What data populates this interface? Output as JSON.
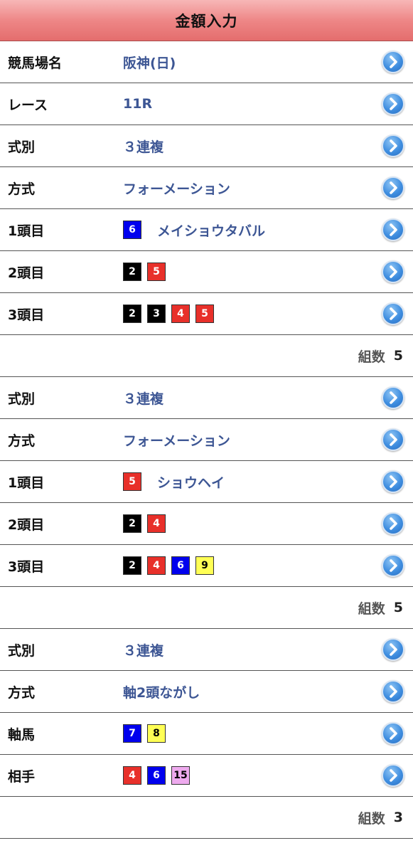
{
  "header": {
    "title": "金額入力"
  },
  "colors": {
    "header_gradient_top": "#f7b7b7",
    "header_gradient_bottom": "#e46d6d",
    "value_text": "#3d5694",
    "blue": "#0000ee",
    "red": "#e8302a",
    "black": "#000000",
    "yellow": "#ffff55",
    "pink": "#eeaaee"
  },
  "top": {
    "venue": {
      "label": "競馬場名",
      "value": "阪神(日)"
    },
    "race": {
      "label": "レース",
      "value": "11R"
    }
  },
  "bets": [
    {
      "type": {
        "label": "式別",
        "value": "３連複"
      },
      "method": {
        "label": "方式",
        "value": "フォーメーション"
      },
      "first": {
        "label": "1頭目",
        "numbers": [
          {
            "n": "6",
            "color": "blue"
          }
        ],
        "horse": "メイショウタバル"
      },
      "second": {
        "label": "2頭目",
        "numbers": [
          {
            "n": "2",
            "color": "black"
          },
          {
            "n": "5",
            "color": "red"
          }
        ]
      },
      "third": {
        "label": "3頭目",
        "numbers": [
          {
            "n": "2",
            "color": "black"
          },
          {
            "n": "3",
            "color": "black"
          },
          {
            "n": "4",
            "color": "red"
          },
          {
            "n": "5",
            "color": "red"
          }
        ]
      },
      "count": {
        "label": "組数",
        "value": "5"
      }
    },
    {
      "type": {
        "label": "式別",
        "value": "３連複"
      },
      "method": {
        "label": "方式",
        "value": "フォーメーション"
      },
      "first": {
        "label": "1頭目",
        "numbers": [
          {
            "n": "5",
            "color": "red"
          }
        ],
        "horse": "ショウヘイ"
      },
      "second": {
        "label": "2頭目",
        "numbers": [
          {
            "n": "2",
            "color": "black"
          },
          {
            "n": "4",
            "color": "red"
          }
        ]
      },
      "third": {
        "label": "3頭目",
        "numbers": [
          {
            "n": "2",
            "color": "black"
          },
          {
            "n": "4",
            "color": "red"
          },
          {
            "n": "6",
            "color": "blue"
          },
          {
            "n": "9",
            "color": "yellow"
          }
        ]
      },
      "count": {
        "label": "組数",
        "value": "5"
      }
    },
    {
      "type": {
        "label": "式別",
        "value": "３連複"
      },
      "method": {
        "label": "方式",
        "value": "軸2頭ながし"
      },
      "axis": {
        "label": "軸馬",
        "numbers": [
          {
            "n": "7",
            "color": "blue"
          },
          {
            "n": "8",
            "color": "yellow"
          }
        ]
      },
      "partner": {
        "label": "相手",
        "numbers": [
          {
            "n": "4",
            "color": "red"
          },
          {
            "n": "6",
            "color": "blue"
          },
          {
            "n": "15",
            "color": "pink"
          }
        ]
      },
      "count": {
        "label": "組数",
        "value": "3"
      }
    }
  ]
}
